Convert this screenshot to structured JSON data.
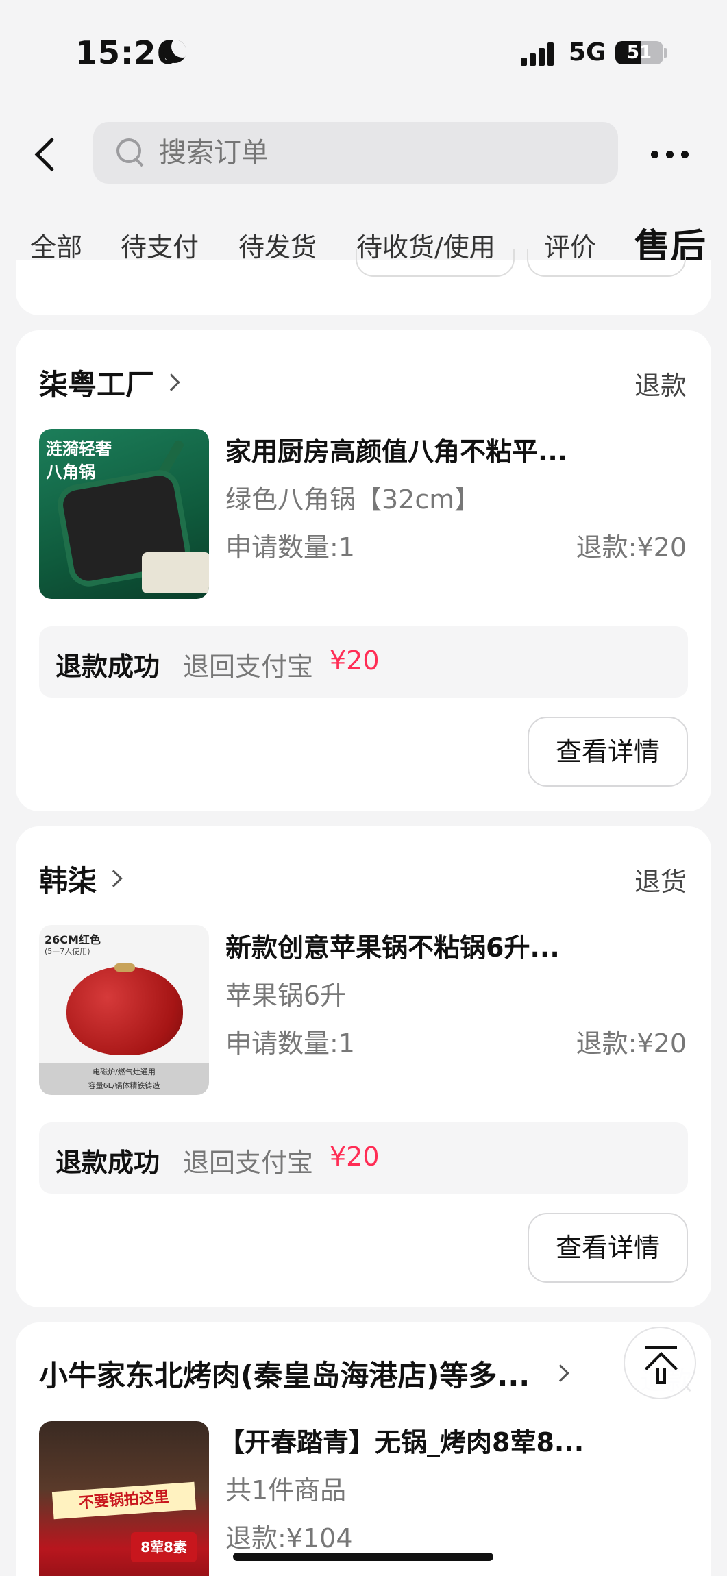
{
  "status_bar": {
    "time": "15:26",
    "network": "5G",
    "battery": "51"
  },
  "header": {
    "search_placeholder": "搜索订单"
  },
  "tabs": [
    "全部",
    "待支付",
    "待发货",
    "待收货/使用",
    "评价",
    "售后"
  ],
  "active_tab_index": 5,
  "orders": [
    {
      "shop": "柒粤工厂",
      "type": "退款",
      "image_tag": [
        "涟漪轻奢",
        "八角锅"
      ],
      "title": "家用厨房高颜值八角不粘平...",
      "spec": "绿色八角锅【32cm】",
      "qty": "申请数量:1",
      "refund": "退款:¥20",
      "result_label": "退款成功",
      "result_dest": "退回支付宝",
      "result_amount": "¥20",
      "button": "查看详情"
    },
    {
      "shop": "韩柒",
      "type": "退货",
      "image_tag": [
        "26CM红色",
        "(5—7人使用)",
        "电磁炉/燃气灶通用",
        "容量6L/锅体精铁铸造"
      ],
      "title": "新款创意苹果锅不粘锅6升...",
      "spec": "苹果锅6升",
      "qty": "申请数量:1",
      "refund": "退款:¥20",
      "result_label": "退款成功",
      "result_dest": "退回支付宝",
      "result_amount": "¥20",
      "button": "查看详情"
    },
    {
      "shop": "小牛家东北烤肉(秦皇岛海港店)等多...",
      "image_tag": [
        "不要锅拍这里",
        "8荤8素"
      ],
      "title": "【开春踏青】无锅_烤肉8荤8...",
      "count": "共1件商品",
      "refund": "退款:¥104"
    }
  ],
  "ghost_text": "退款",
  "colors": {
    "accent": "#ff2d55",
    "background": "#f4f4f5"
  }
}
